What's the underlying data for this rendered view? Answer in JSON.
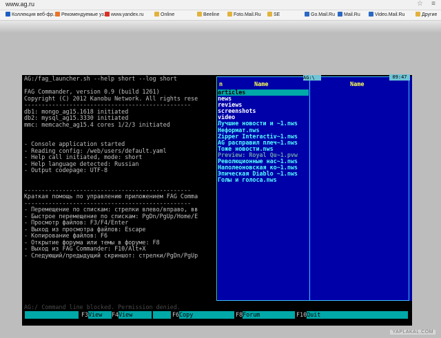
{
  "browser": {
    "url": "www.ag.ru",
    "menu_icon": "hamburger-icon",
    "star_icon": "star-icon"
  },
  "bookmarks": [
    {
      "label": "Коллекция веб-фр...",
      "color": "#1e5fc4"
    },
    {
      "label": "Рекомендуемые уз...",
      "color": "#e6752c"
    },
    {
      "label": "www.yandex.ru",
      "color": "#d93025"
    },
    {
      "label": "Online",
      "color": "#e2b23c"
    },
    {
      "label": "Beeline",
      "color": "#e2b23c"
    },
    {
      "label": "Foto.Mail.Ru",
      "color": "#e2b23c"
    },
    {
      "label": "SE",
      "color": "#e2b23c"
    },
    {
      "label": "Go.Mail.Ru",
      "color": "#2b68c4"
    },
    {
      "label": "Mail.Ru",
      "color": "#2b68c4"
    },
    {
      "label": "Video.Mail.Ru",
      "color": "#2b68c4"
    },
    {
      "label": "Другие",
      "color": "#e2b23c"
    }
  ],
  "terminal": {
    "lines": [
      "AG:/fag_launcher.sh --help short --log short",
      "",
      "FAG Commander, version 0.9 (build 1261)",
      "Copyright (C) 2012 Kanobu Network. All rights rese",
      "------------------------------------------------",
      "db1: mongo_ag15.1618 initiated",
      "db2: mysql_ag15.3330 initiated",
      "mmc: memcache_ag15.4 cores 1/2/3 initiated",
      "",
      "",
      "- Console application started",
      "- Reading config: /web/users/default.yaml",
      "- Help call initiated, mode: short",
      "- Help language detected: Russian",
      "- Output codepage: UTF-8",
      "",
      "",
      "------------------------------------------------",
      "Краткая помощь по управлению приложением FAG Comma",
      "------------------------------------------------",
      "- Перемещение по спискам: стрелки влево/вправо, вв",
      "- Быстрое перемещение по спискам: PgDn/PgUp/Home/E",
      "- Просмотр файлов: F3/F4/Enter",
      "- Выход из просмотра файлов: Escape",
      "- Копирование файлов: F6",
      "- Открытие форума или темы в форуме: F8",
      "- Выход из FAG Commander: F10/Alt+X",
      "- Следующий/предыдущий скриншот: стрелки/PgDn/PgUp"
    ],
    "command_line": "AG:/ Command line blocked. Permission denied."
  },
  "panel": {
    "title": "AG:\\",
    "clock": "09:47",
    "col_n": "n",
    "col_name_left": "Name",
    "col_name_right": "Name",
    "files": [
      {
        "name": "articles",
        "kind": "sel"
      },
      {
        "name": "news",
        "kind": "dir"
      },
      {
        "name": "reviews",
        "kind": "dir"
      },
      {
        "name": "screenshots",
        "kind": "dir"
      },
      {
        "name": "video",
        "kind": "dir"
      },
      {
        "name": "Лучшие новости и ~1.nws",
        "kind": "nws"
      },
      {
        "name": "Неформат.nws",
        "kind": "nws"
      },
      {
        "name": "Zipper Interactiv~1.nws",
        "kind": "nws"
      },
      {
        "name": "AG расправил плеч~1.nws",
        "kind": "nws"
      },
      {
        "name": "Тоже новости.nws",
        "kind": "nws"
      },
      {
        "name": "Preview: Royal Qu~1.pvw",
        "kind": "pvw"
      },
      {
        "name": "Революционные нас~1.nws",
        "kind": "nws"
      },
      {
        "name": "Наполеоновская ко~1.nws",
        "kind": "nws"
      },
      {
        "name": "Эпическая Diablo ~1.nws",
        "kind": "nws"
      },
      {
        "name": "Голы и голоса.nws",
        "kind": "nws"
      }
    ]
  },
  "fkeys": [
    {
      "num": "F3",
      "label": "View"
    },
    {
      "num": "F4",
      "label": "View"
    },
    {
      "num": "F6",
      "label": "Copy"
    },
    {
      "num": "F8",
      "label": "Forum"
    },
    {
      "num": "F10",
      "label": "Quit"
    }
  ],
  "watermark": "YAPLAKAL.COM"
}
